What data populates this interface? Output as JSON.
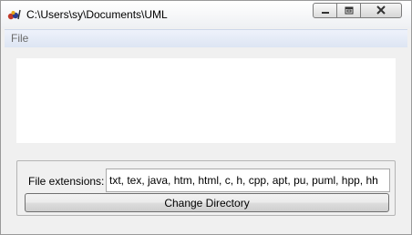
{
  "window": {
    "title": "C:\\Users\\sy\\Documents\\UML",
    "icon": "app-icon"
  },
  "menu": {
    "items": [
      {
        "label": "File"
      }
    ]
  },
  "form": {
    "extensions_label": "File extensions:",
    "extensions_value": "txt, tex, java, htm, html, c, h, cpp, apt, pu, puml, hpp, hh",
    "change_directory_label": "Change Directory"
  },
  "window_controls": [
    "minimize-icon",
    "restore-icon",
    "close-icon"
  ]
}
